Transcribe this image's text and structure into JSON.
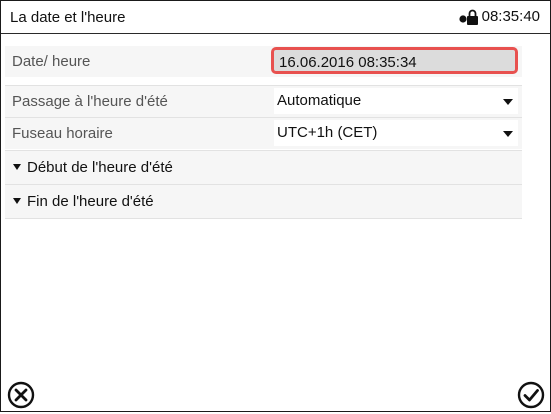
{
  "header": {
    "title": "La date et l'heure",
    "time": "08:35:40",
    "lock_icon": "lock-icon"
  },
  "rows": [
    {
      "label": "Date/ heure",
      "value": "16.06.2016 08:35:34",
      "type": "text-field"
    },
    {
      "label": "Passage à l'heure d'été",
      "value": "Automatique",
      "type": "dropdown"
    },
    {
      "label": "Fuseau horaire",
      "value": "UTC+1h (CET)",
      "type": "dropdown"
    }
  ],
  "sections": [
    {
      "label": "Début de l'heure d'été"
    },
    {
      "label": "Fin de l'heure d'été"
    }
  ],
  "footer": {
    "cancel_icon": "cancel-circle-x-icon",
    "confirm_icon": "confirm-circle-check-icon"
  },
  "colors": {
    "focus_border": "#e8514f",
    "field_bg": "#dcdcdc",
    "row_bg": "#f6f6f6"
  }
}
